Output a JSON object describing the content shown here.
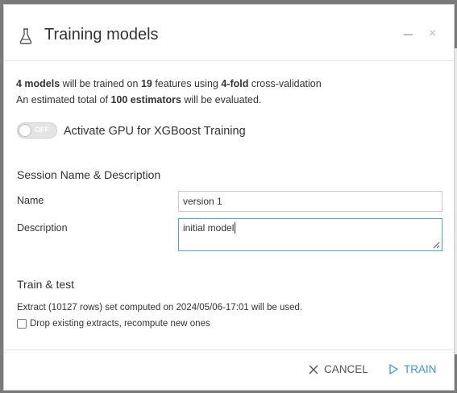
{
  "dialog": {
    "title": "Training models",
    "close_symbol": "×"
  },
  "summary": {
    "line1": {
      "models": "4 models",
      "t1": " will be trained on ",
      "features": "19",
      "t2": " features using ",
      "folds": "4-fold",
      "t3": " cross-validation"
    },
    "line2": {
      "t1": "An estimated total of ",
      "estimators": "100 estimators",
      "t2": " will be evaluated."
    }
  },
  "gpu": {
    "toggle_state": "OFF",
    "label": "Activate GPU for XGBoost Training"
  },
  "session": {
    "heading": "Session Name & Description",
    "name_label": "Name",
    "name_value": "version 1",
    "description_label": "Description",
    "description_value": "initial model"
  },
  "train_test": {
    "heading": "Train & test",
    "extract_text": "Extract (10127 rows) set computed on 2024/05/06-17:01 will be used.",
    "drop_label": "Drop existing extracts, recompute new ones",
    "drop_checked": false
  },
  "footer": {
    "cancel_label": "CANCEL",
    "train_label": "TRAIN"
  },
  "colors": {
    "accent": "#3c9ad8",
    "text": "#333333",
    "muted": "#bdbdbd"
  },
  "icons": {
    "title_icon": "flask-icon",
    "cancel_icon": "close-x-icon",
    "train_icon": "play-triangle-icon"
  }
}
